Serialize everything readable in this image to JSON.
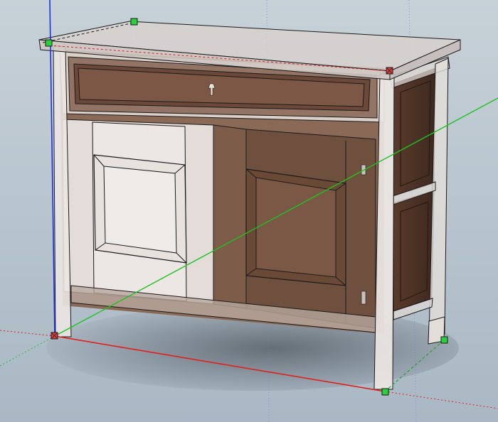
{
  "app": {
    "kind": "3d-modeling-viewport",
    "view": "perspective"
  },
  "colors": {
    "sky_top": "#c7d1d8",
    "sky_bottom": "#a9b8c4",
    "axis_red": "#e0201a",
    "axis_green": "#1fc21f",
    "axis_blue": "#1f2fe0",
    "wood_dark": "#5a3a2b",
    "wood_mid": "#7d5a44",
    "ghost_fill": "#e8e4e2",
    "edge": "#1b1b1b",
    "grip_green": "#26d13a",
    "grip_red": "#e53a3a",
    "guide_blue": "#6f7fe6"
  },
  "model": {
    "object": "cabinet",
    "parts": [
      "top",
      "drawer",
      "left-door",
      "right-door",
      "side-panels",
      "legs"
    ]
  }
}
